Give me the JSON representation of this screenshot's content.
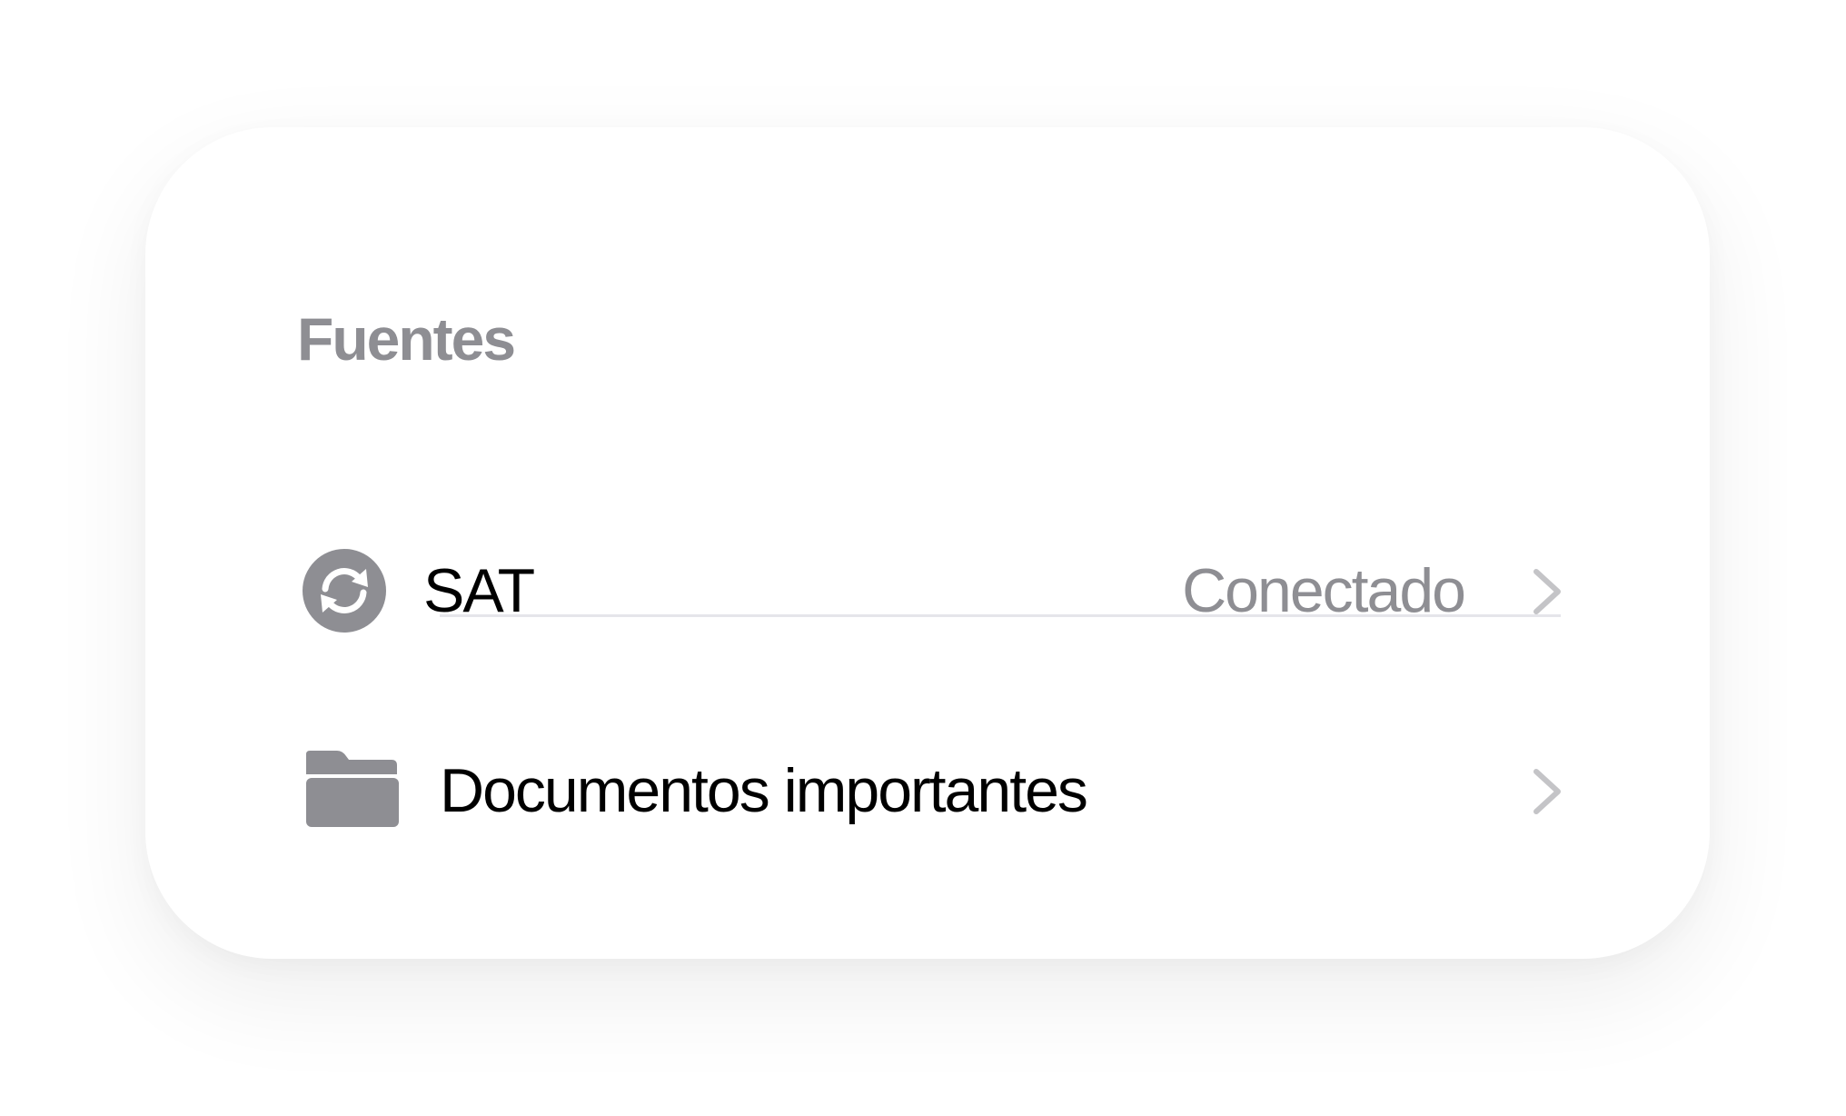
{
  "section": {
    "title": "Fuentes"
  },
  "rows": [
    {
      "label": "SAT",
      "status": "Conectado",
      "icon": "sync-icon"
    },
    {
      "label": "Documentos importantes",
      "icon": "folder-icon"
    }
  ],
  "colors": {
    "secondary_text": "#8e8e93",
    "icon_gray": "#8e8e93",
    "chevron": "#c4c4c7",
    "divider": "#e5e5ea",
    "primary_text": "#000000"
  }
}
